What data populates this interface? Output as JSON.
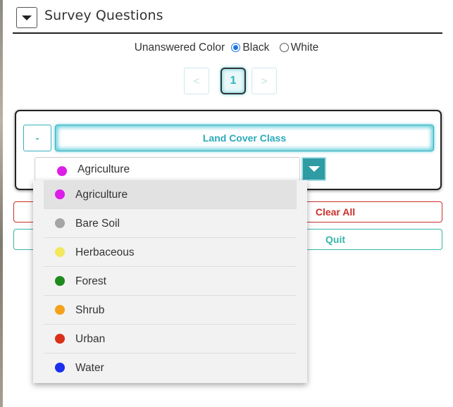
{
  "header": {
    "title": "Survey Questions",
    "collapse_icon": "caret-down-icon"
  },
  "unanswered_color": {
    "label": "Unanswered Color",
    "options": [
      {
        "label": "Black",
        "checked": true
      },
      {
        "label": "White",
        "checked": false
      }
    ]
  },
  "pagination": {
    "prev": "<",
    "current": "1",
    "next": ">"
  },
  "question": {
    "collapse_label": "-",
    "title": "Land Cover Class",
    "selected": {
      "label": "Agriculture",
      "color": "#dd1ee8"
    }
  },
  "actions": {
    "clear_all": "Clear All",
    "quit": "Quit"
  },
  "dropdown": {
    "options": [
      {
        "label": "Agriculture",
        "color": "#dd1ee8",
        "highlighted": true
      },
      {
        "label": "Bare Soil",
        "color": "#a5a5a5"
      },
      {
        "label": "Herbaceous",
        "color": "#f2e75d"
      },
      {
        "label": "Forest",
        "color": "#1e8a1e"
      },
      {
        "label": "Shrub",
        "color": "#f4a21c"
      },
      {
        "label": "Urban",
        "color": "#d9301a"
      },
      {
        "label": "Water",
        "color": "#1a2ff0"
      }
    ]
  },
  "colors": {
    "accent": "#36b0bf",
    "danger": "#c9302c",
    "quit": "#37b5a8"
  }
}
